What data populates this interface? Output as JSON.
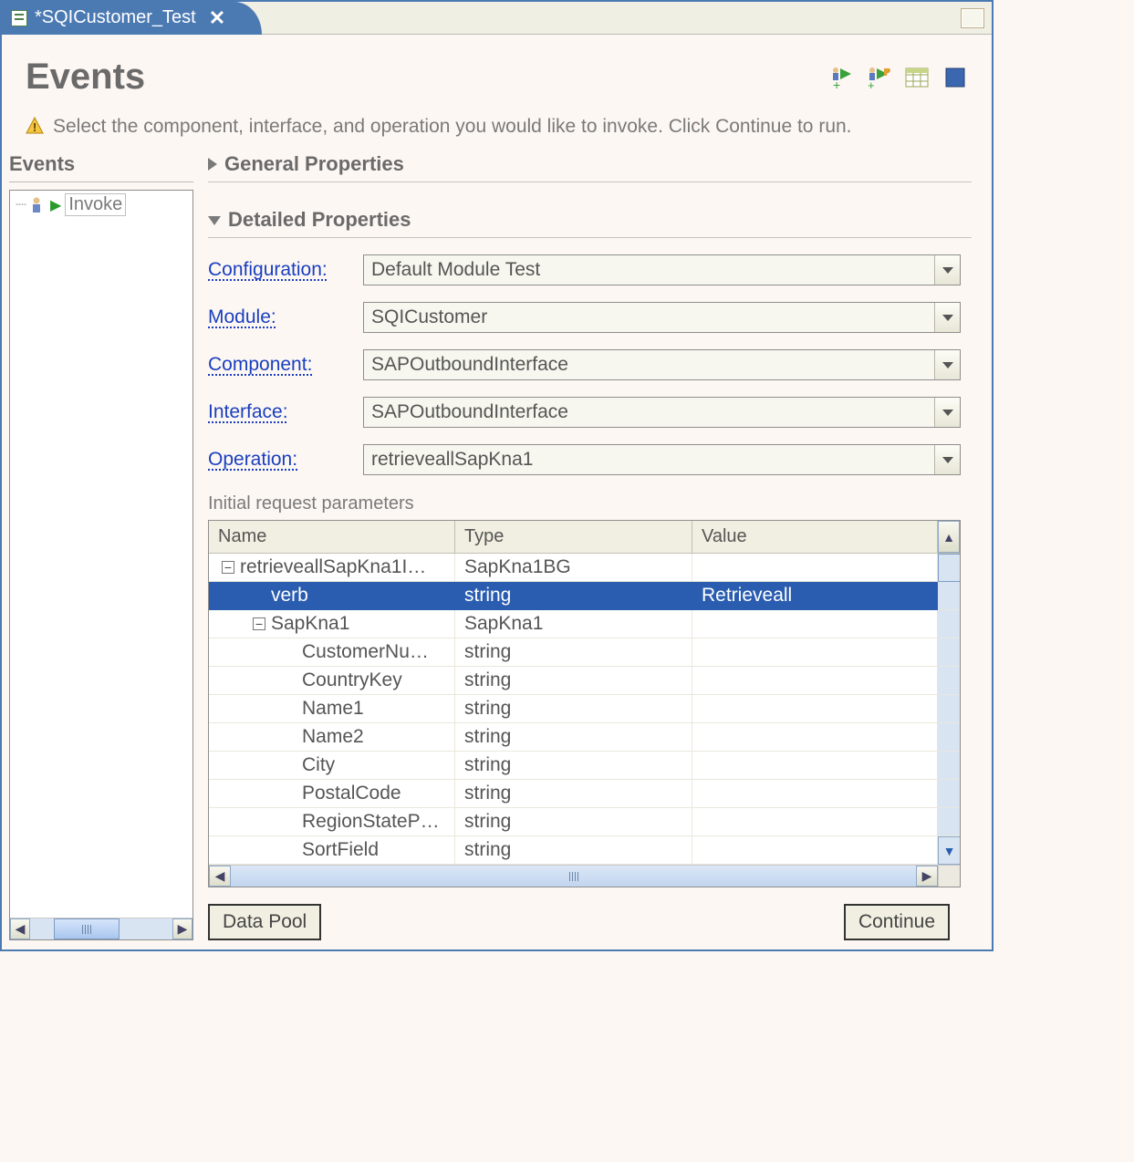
{
  "tab": {
    "title": "*SQICustomer_Test"
  },
  "page": {
    "heading": "Events"
  },
  "info": {
    "text": "Select the component, interface, and operation you would like to invoke. Click Continue to run."
  },
  "sidebar": {
    "title": "Events",
    "tree": {
      "invoke_label": "Invoke"
    }
  },
  "sections": {
    "general_label": "General Properties",
    "detailed_label": "Detailed Properties"
  },
  "form": {
    "configuration_label": "Configuration:",
    "configuration_value": "Default Module Test",
    "module_label": "Module:",
    "module_value": "SQICustomer",
    "component_label": "Component:",
    "component_value": "SAPOutboundInterface",
    "interface_label": "Interface:",
    "interface_value": "SAPOutboundInterface",
    "operation_label": "Operation:",
    "operation_value": "retrieveallSapKna1",
    "params_caption": "Initial request parameters"
  },
  "table": {
    "headers": {
      "name": "Name",
      "type": "Type",
      "value": "Value"
    },
    "rows": [
      {
        "indent": 0,
        "toggle": "-",
        "name": "retrieveallSapKna1I…",
        "type": "SapKna1BG",
        "value": "",
        "selected": false
      },
      {
        "indent": 1,
        "toggle": "",
        "name": "verb",
        "type": "string",
        "value": "Retrieveall",
        "selected": true
      },
      {
        "indent": 1,
        "toggle": "-",
        "name": "SapKna1",
        "type": "SapKna1",
        "value": "",
        "selected": false
      },
      {
        "indent": 2,
        "toggle": "",
        "name": "CustomerNu…",
        "type": "string",
        "value": "",
        "selected": false
      },
      {
        "indent": 2,
        "toggle": "",
        "name": "CountryKey",
        "type": "string",
        "value": "",
        "selected": false
      },
      {
        "indent": 2,
        "toggle": "",
        "name": "Name1",
        "type": "string",
        "value": "",
        "selected": false
      },
      {
        "indent": 2,
        "toggle": "",
        "name": "Name2",
        "type": "string",
        "value": "",
        "selected": false
      },
      {
        "indent": 2,
        "toggle": "",
        "name": "City",
        "type": "string",
        "value": "",
        "selected": false
      },
      {
        "indent": 2,
        "toggle": "",
        "name": "PostalCode",
        "type": "string",
        "value": "",
        "selected": false
      },
      {
        "indent": 2,
        "toggle": "",
        "name": "RegionStateP…",
        "type": "string",
        "value": "",
        "selected": false
      },
      {
        "indent": 2,
        "toggle": "",
        "name": "SortField",
        "type": "string",
        "value": "",
        "selected": false
      }
    ]
  },
  "buttons": {
    "data_pool": "Data Pool",
    "continue": "Continue"
  }
}
